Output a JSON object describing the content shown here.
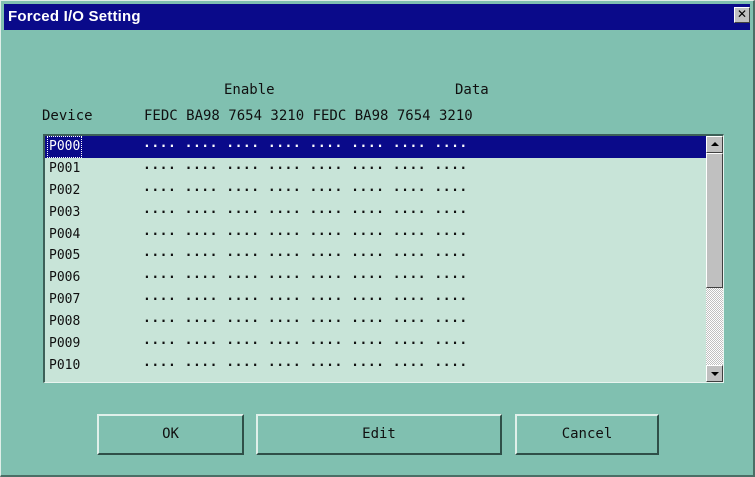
{
  "window": {
    "title": "Forced I/O Setting",
    "close_glyph": "✕"
  },
  "header": {
    "enable_label": "Enable",
    "data_label": "Data",
    "device_label": "Device",
    "bit_groups": "FEDC BA98 7654 3210 FEDC BA98 7654 3210"
  },
  "list": {
    "selected_index": 0,
    "rows": [
      {
        "device": "P000",
        "values": ".... .... .... .... .... .... .... ...."
      },
      {
        "device": "P001",
        "values": ".... .... .... .... .... .... .... ...."
      },
      {
        "device": "P002",
        "values": ".... .... .... .... .... .... .... ...."
      },
      {
        "device": "P003",
        "values": ".... .... .... .... .... .... .... ...."
      },
      {
        "device": "P004",
        "values": ".... .... .... .... .... .... .... ...."
      },
      {
        "device": "P005",
        "values": ".... .... .... .... .... .... .... ...."
      },
      {
        "device": "P006",
        "values": ".... .... .... .... .... .... .... ...."
      },
      {
        "device": "P007",
        "values": ".... .... .... .... .... .... .... ...."
      },
      {
        "device": "P008",
        "values": ".... .... .... .... .... .... .... ...."
      },
      {
        "device": "P009",
        "values": ".... .... .... .... .... .... .... ...."
      },
      {
        "device": "P010",
        "values": ".... .... .... .... .... .... .... ...."
      }
    ]
  },
  "buttons": {
    "ok": "OK",
    "edit": "Edit",
    "cancel": "Cancel"
  },
  "colors": {
    "dialog_background": "#80c0b0",
    "title_bar": "#0a0a8a",
    "list_background": "#c8e4d8",
    "selection": "#0a0a8a"
  }
}
